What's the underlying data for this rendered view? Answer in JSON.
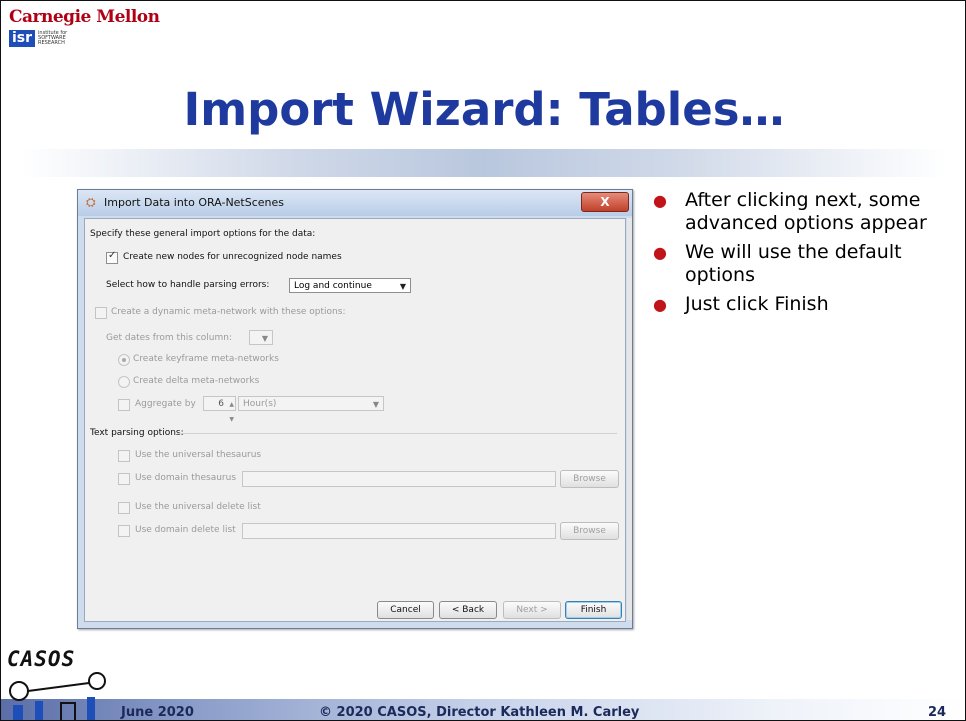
{
  "logo": {
    "university": "Carnegie Mellon",
    "institute_abbr": "isr",
    "institute_lines": [
      "institute for",
      "SOFTWARE",
      "RESEARCH"
    ]
  },
  "title": "Import Wizard: Tables…",
  "bullets": [
    "After clicking next, some advanced options appear",
    "We will use the default options",
    "Just click Finish"
  ],
  "dialog": {
    "title": "Import Data into ORA-NetScenes",
    "close_label": "X",
    "general_heading": "Specify these general import options for the data:",
    "create_nodes_label": "Create new nodes for unrecognized node names",
    "create_nodes_checked": true,
    "parsing_errors_label": "Select how to handle parsing errors:",
    "parsing_errors_value": "Log and continue",
    "dynamic_label": "Create a dynamic meta-network with these options:",
    "dates_column_label": "Get dates from this column:",
    "keyframe_label": "Create keyframe meta-networks",
    "delta_label": "Create delta meta-networks",
    "aggregate_label": "Aggregate by",
    "aggregate_value": "6",
    "aggregate_unit": "Hour(s)",
    "text_parsing_heading": "Text parsing options:",
    "universal_thesaurus_label": "Use the universal thesaurus",
    "domain_thesaurus_label": "Use domain thesaurus",
    "universal_delete_label": "Use the universal delete list",
    "domain_delete_label": "Use domain delete list",
    "browse_label": "Browse",
    "buttons": {
      "cancel": "Cancel",
      "back": "< Back",
      "next": "Next >",
      "finish": "Finish"
    }
  },
  "footer": {
    "date": "June 2020",
    "copyright": "© 2020 CASOS, Director Kathleen M. Carley",
    "page": "24",
    "casos_logo": "CASOS"
  }
}
